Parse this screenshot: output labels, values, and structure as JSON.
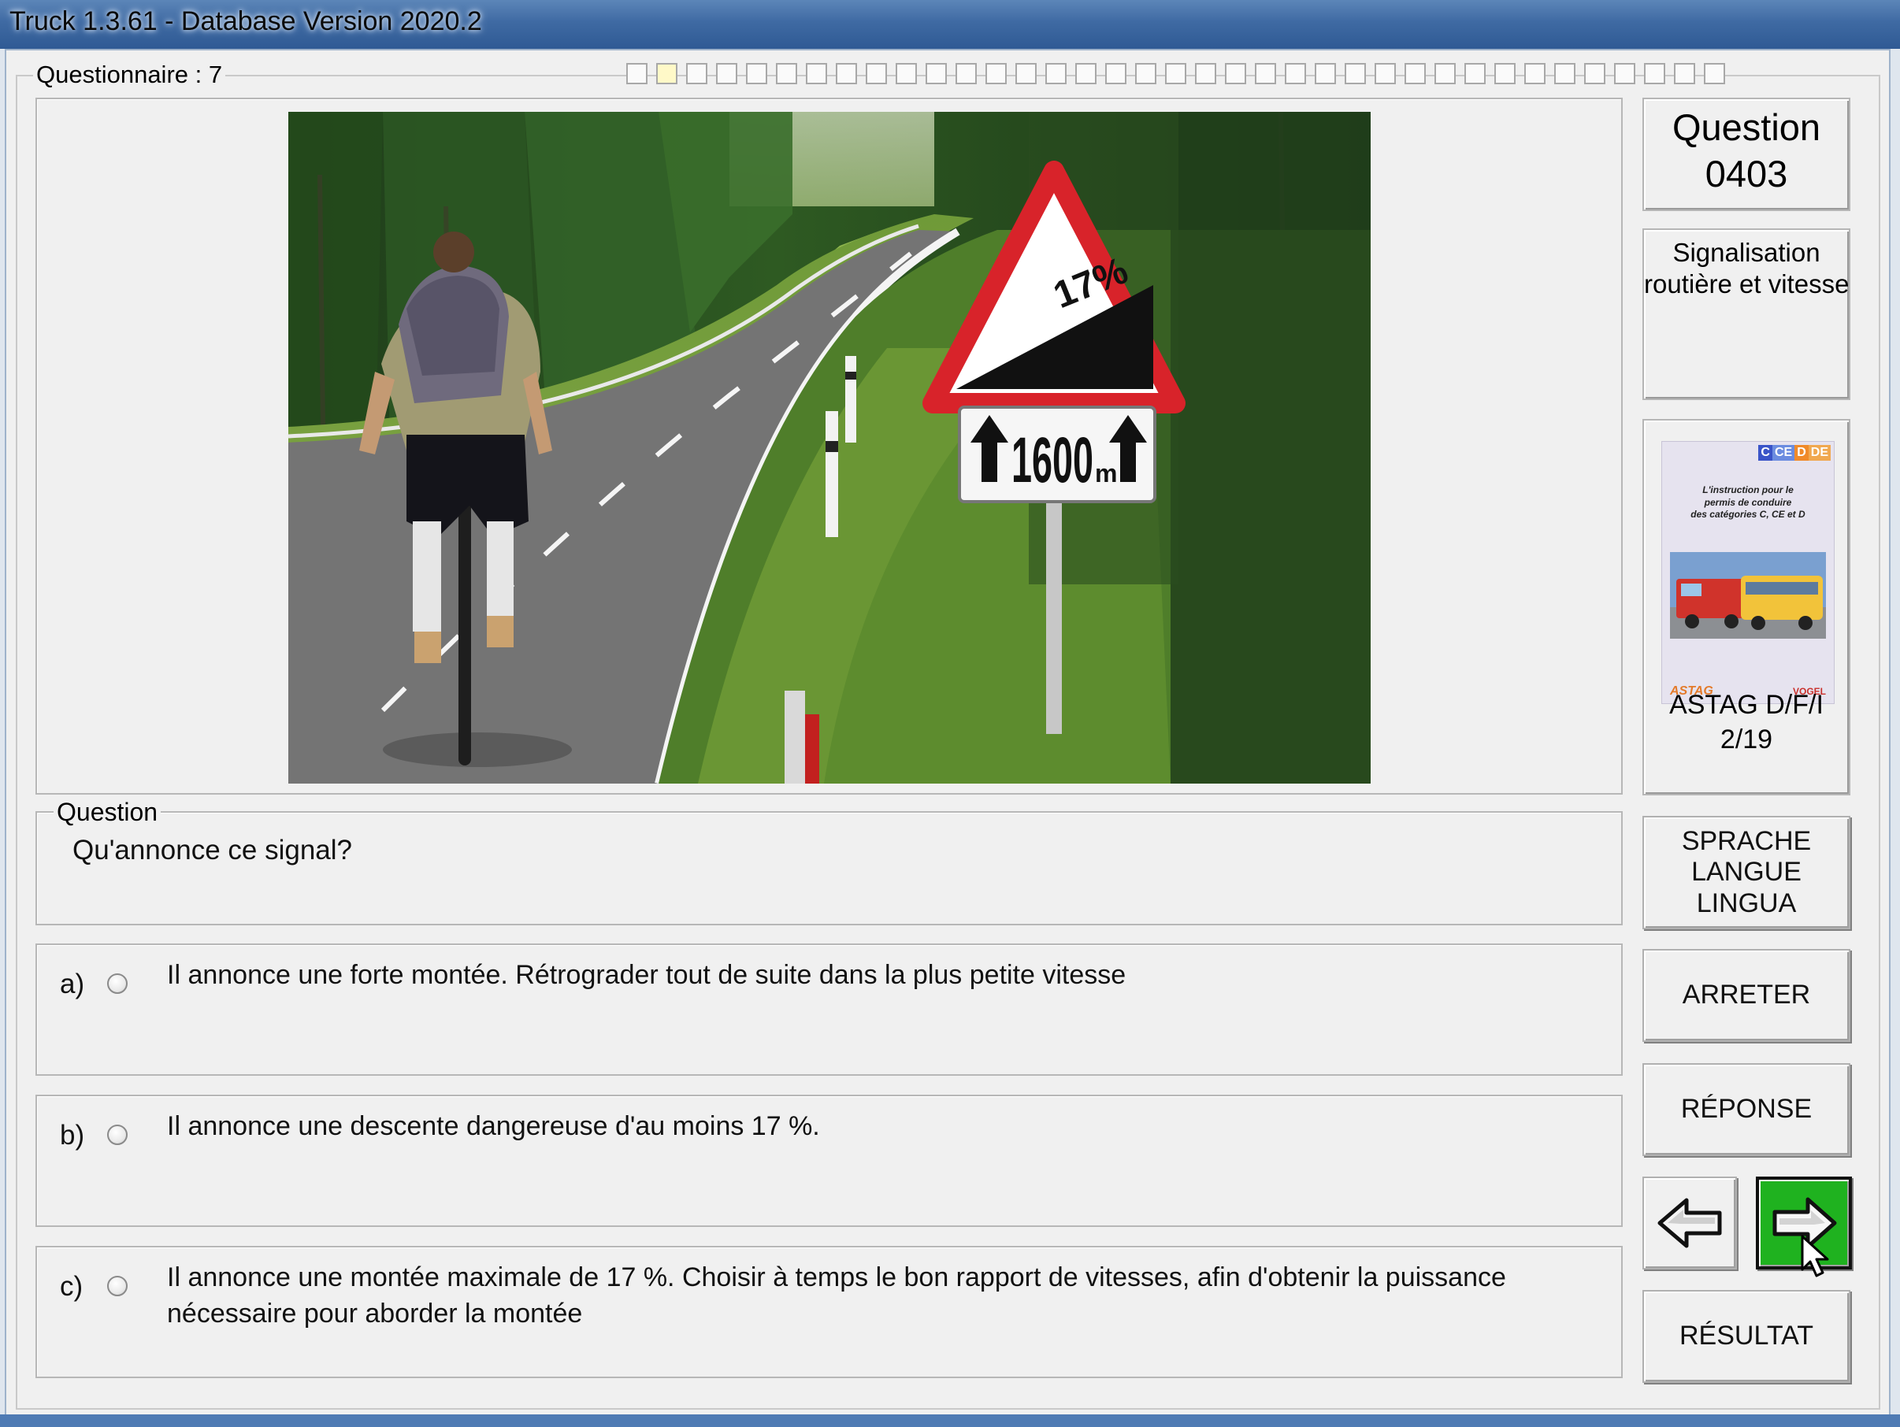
{
  "window": {
    "title": "Truck 1.3.61 - Database Version 2020.2"
  },
  "questionnaire": {
    "label": "Questionnaire : 7",
    "progress_total": 37,
    "progress_done": 1
  },
  "question_number": {
    "label": "Question",
    "number": "0403"
  },
  "category": {
    "line1": "Signalisation",
    "line2": "routière et vitesse"
  },
  "book": {
    "badges": [
      "C",
      "CE",
      "D",
      "DE"
    ],
    "cover_text": [
      "L'instruction pour le",
      "permis de conduire",
      "des catégories C, CE et D"
    ],
    "logo_left": "ASTAG",
    "logo_right": "VOGEL",
    "caption_line1": "ASTAG D/F/I",
    "caption_line2": "2/19"
  },
  "question": {
    "legend": "Question",
    "text": "Qu'annonce ce signal?"
  },
  "sign": {
    "grade": "17%",
    "distance": "1600",
    "unit": "m"
  },
  "answers": [
    {
      "letter": "a)",
      "text": "Il annonce une forte montée. Rétrograder tout de suite dans la plus petite vitesse"
    },
    {
      "letter": "b)",
      "text": "Il annonce une descente dangereuse d'au moins 17 %."
    },
    {
      "letter": "c)",
      "text": "Il annonce une montée maximale de 17 %. Choisir à temps le bon rapport de vitesses, afin d'obtenir la puissance nécessaire pour aborder la montée"
    }
  ],
  "buttons": {
    "language": [
      "SPRACHE",
      "LANGUE",
      "LINGUA"
    ],
    "stop": "ARRETER",
    "answer": "RÉPONSE",
    "result": "RÉSULTAT"
  },
  "colors": {
    "next_button": "#1fb21f",
    "progress_done": "#fff9c8",
    "sign_red": "#d8232a"
  }
}
